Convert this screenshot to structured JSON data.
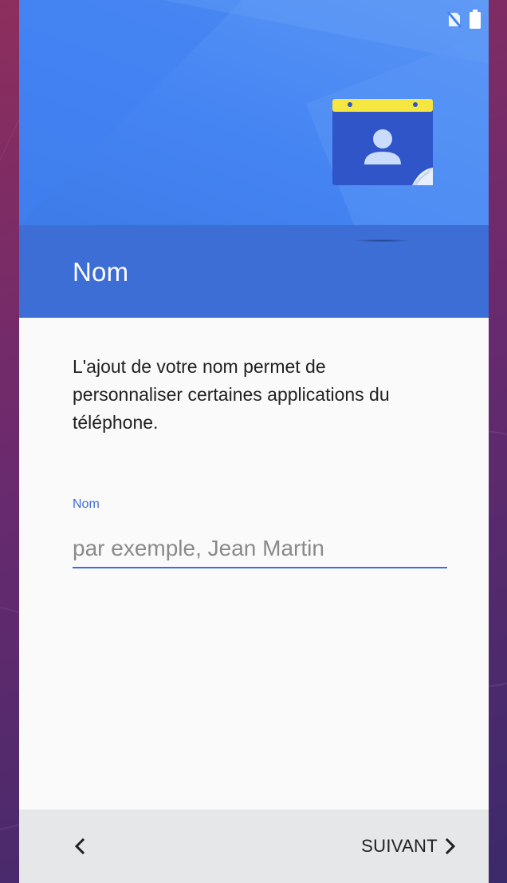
{
  "screen": {
    "title": "Nom",
    "description": "L'ajout de votre nom permet de personnaliser certaines applications du téléphone."
  },
  "form": {
    "name_label": "Nom",
    "name_value": "",
    "name_placeholder": "par exemple, Jean Martin"
  },
  "navigation": {
    "back_icon": "chevron-left-icon",
    "next_label": "SUIVANT",
    "next_icon": "chevron-right-icon"
  },
  "status_bar": {
    "icons": [
      "no-sim-icon",
      "battery-full-icon"
    ]
  },
  "illustration": {
    "icon": "contact-card-icon"
  },
  "colors": {
    "hero_blue": "#4585f3",
    "accent_blue": "#3d6ed6",
    "card_yellow": "#f5e642",
    "card_blue": "#2f55c8",
    "nav_bar_bg": "#e6e7e8"
  }
}
